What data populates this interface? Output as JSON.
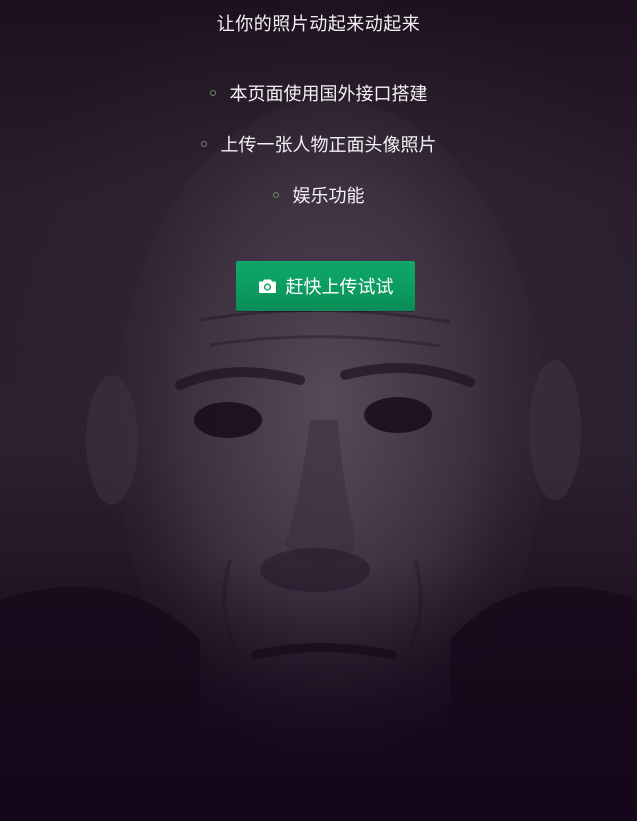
{
  "header": {
    "title": "让你的照片动起来动起来"
  },
  "features": [
    {
      "text": "本页面使用国外接口搭建"
    },
    {
      "text": "上传一张人物正面头像照片"
    },
    {
      "text": "娱乐功能"
    }
  ],
  "upload_button": {
    "label": "赶快上传试试",
    "icon": "camera-icon"
  },
  "background": {
    "image": "elderly-man-portrait",
    "icon": "portrait-photo"
  },
  "colors": {
    "background": "#1a0f1c",
    "button": "#0fa86a",
    "bullet": "#6b8a62",
    "text": "#f2f2f2"
  }
}
